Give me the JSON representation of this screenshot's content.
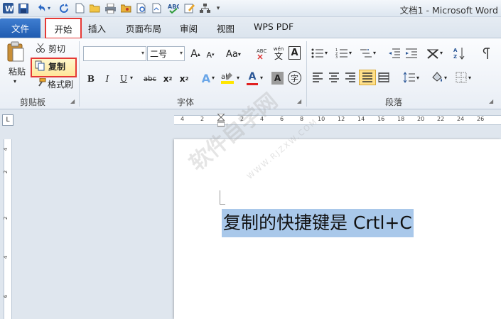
{
  "window": {
    "title": "文档1 - Microsoft Word"
  },
  "tabs": {
    "file": "文件",
    "items": [
      "开始",
      "插入",
      "页面布局",
      "审阅",
      "视图",
      "WPS PDF"
    ]
  },
  "clipboard": {
    "paste": "粘贴",
    "cut": "剪切",
    "copy": "复制",
    "format_painter": "格式刷",
    "label": "剪贴板"
  },
  "font": {
    "name_value": "",
    "size_value": "二号",
    "label": "字体",
    "case_label": "Aa",
    "wen_label": "wén"
  },
  "paragraph": {
    "label": "段落"
  },
  "ruler": {
    "numbers": [
      "4",
      "2",
      "2",
      "4",
      "6",
      "8",
      "10",
      "12",
      "14",
      "16",
      "18",
      "20",
      "22",
      "24",
      "26"
    ]
  },
  "vruler": {
    "numbers": [
      "4",
      "2",
      "2",
      "4",
      "6"
    ]
  },
  "document": {
    "selected_text": "复制的快捷键是 Crtl+C",
    "watermark": "软件自学网",
    "watermark_url": "WWW.RJZXW.COM"
  },
  "colors": {
    "accent": "#2b5797",
    "highlight": "#a9c8ea",
    "callout": "#e53935",
    "file_tab": "#2a66c0"
  }
}
